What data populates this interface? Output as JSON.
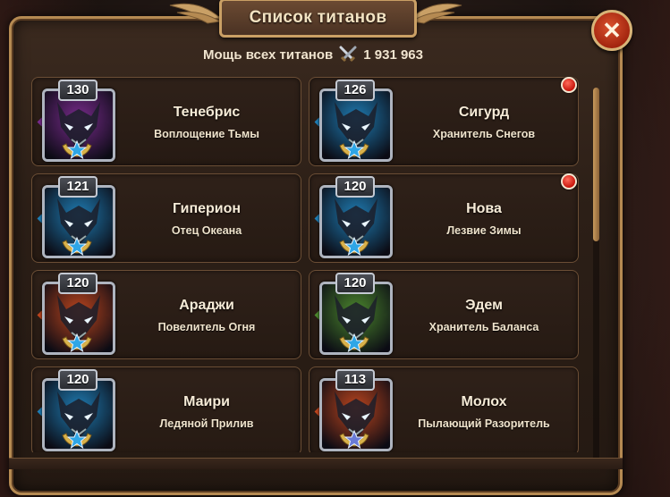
{
  "header": {
    "title": "Список титанов"
  },
  "power": {
    "label": "Мощь всех титанов",
    "value": "1 931 963"
  },
  "titans": [
    {
      "name": "Тенебрис",
      "title": "Воплощение Тьмы",
      "level": "130",
      "notification": false,
      "element": "dark",
      "star_color": "#2fa6e6"
    },
    {
      "name": "Сигурд",
      "title": "Хранитель Снегов",
      "level": "126",
      "notification": true,
      "element": "water",
      "star_color": "#2fa6e6"
    },
    {
      "name": "Гиперион",
      "title": "Отец Океана",
      "level": "121",
      "notification": false,
      "element": "water",
      "star_color": "#2fa6e6"
    },
    {
      "name": "Нова",
      "title": "Лезвие Зимы",
      "level": "120",
      "notification": true,
      "element": "water",
      "star_color": "#2fa6e6"
    },
    {
      "name": "Араджи",
      "title": "Повелитель Огня",
      "level": "120",
      "notification": false,
      "element": "fire",
      "star_color": "#2fa6e6"
    },
    {
      "name": "Эдем",
      "title": "Хранитель Баланса",
      "level": "120",
      "notification": false,
      "element": "earth",
      "star_color": "#2fa6e6"
    },
    {
      "name": "Маири",
      "title": "Ледяной Прилив",
      "level": "120",
      "notification": false,
      "element": "water",
      "star_color": "#2fa6e6"
    },
    {
      "name": "Молох",
      "title": "Пылающий Разоритель",
      "level": "113",
      "notification": false,
      "element": "fire",
      "star_color": "#6a7bd6"
    }
  ],
  "colors": {
    "dark": "#7a2b8f",
    "water": "#1e7fb8",
    "fire": "#c0461e",
    "earth": "#4c8a2e",
    "notification": "#d41d10",
    "frame_gold": "#b58a52"
  },
  "icons": {
    "close": "close-icon",
    "power": "crossed-swords-icon"
  },
  "close_label": "✕",
  "scroll": {
    "position": 0.0
  }
}
